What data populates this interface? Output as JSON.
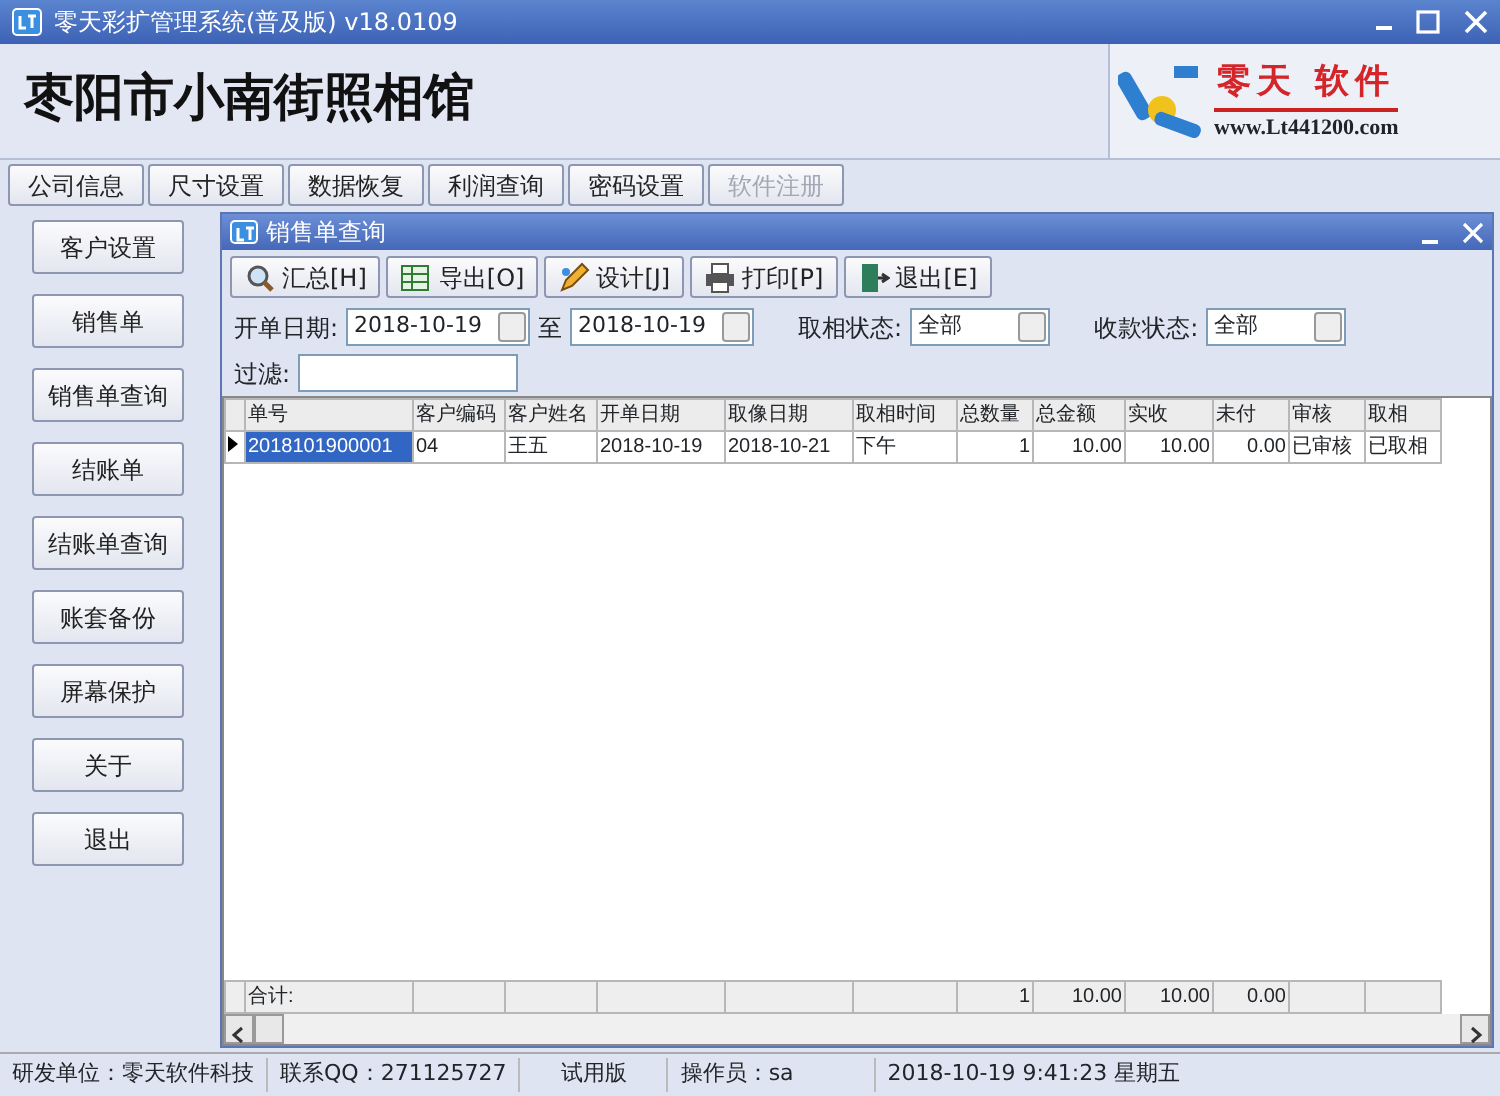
{
  "window": {
    "title": "零天彩扩管理系统(普及版)  v18.0109"
  },
  "header": {
    "studio_name": "枣阳市小南街照相馆",
    "logo_text": "零天 软件",
    "logo_url": "www.Lt441200.com"
  },
  "tabs": [
    {
      "label": "公司信息",
      "disabled": false
    },
    {
      "label": "尺寸设置",
      "disabled": false
    },
    {
      "label": "数据恢复",
      "disabled": false
    },
    {
      "label": "利润查询",
      "disabled": false
    },
    {
      "label": "密码设置",
      "disabled": false
    },
    {
      "label": "软件注册",
      "disabled": true
    }
  ],
  "sidebar": {
    "items": [
      "客户设置",
      "销售单",
      "销售单查询",
      "结账单",
      "结账单查询",
      "账套备份",
      "屏幕保护",
      "关于",
      "退出"
    ]
  },
  "child_window": {
    "title": "销售单查询",
    "toolbar": [
      {
        "label": "汇总[H]",
        "kind": "summary"
      },
      {
        "label": "导出[O]",
        "kind": "export"
      },
      {
        "label": "设计[J]",
        "kind": "design"
      },
      {
        "label": "打印[P]",
        "kind": "print"
      },
      {
        "label": "退出[E]",
        "kind": "exit"
      }
    ],
    "filters": {
      "start_label": "开单日期:",
      "start_value": "2018-10-19",
      "to_label": "至",
      "end_value": "2018-10-19",
      "pickup_label": "取相状态:",
      "pickup_value": "全部",
      "payment_label": "收款状态:",
      "payment_value": "全部",
      "filter_label": "过滤:"
    },
    "table": {
      "columns": [
        {
          "label": "单号",
          "kind": "text"
        },
        {
          "label": "客户编码",
          "kind": "text"
        },
        {
          "label": "客户姓名",
          "kind": "text"
        },
        {
          "label": "开单日期",
          "kind": "text"
        },
        {
          "label": "取像日期",
          "kind": "text"
        },
        {
          "label": "取相时间",
          "kind": "text"
        },
        {
          "label": "总数量",
          "kind": "number",
          "total": "1"
        },
        {
          "label": "总金额",
          "kind": "number",
          "total": "10.00"
        },
        {
          "label": "实收",
          "kind": "number",
          "total": "10.00"
        },
        {
          "label": "未付",
          "kind": "number",
          "total": "0.00"
        },
        {
          "label": "审核",
          "kind": "text"
        },
        {
          "label": "取相",
          "kind": "text"
        }
      ],
      "rows": [
        {
          "selected": true,
          "cells": [
            "2018101900001",
            "04",
            "王五",
            "2018-10-19",
            "2018-10-21",
            "下午",
            "1",
            "10.00",
            "10.00",
            "0.00",
            "已审核",
            "已取相"
          ]
        }
      ],
      "totals_label": "合计:"
    }
  },
  "status_bar": [
    "研发单位：零天软件科技",
    "联系QQ：271125727",
    "试用版",
    "操作员：sa",
    "2018-10-19 9:41:23 星期五"
  ]
}
